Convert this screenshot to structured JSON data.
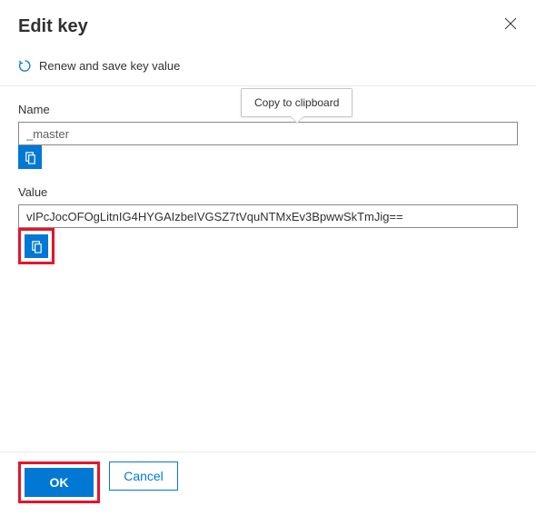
{
  "dialog": {
    "title": "Edit key"
  },
  "toolbar": {
    "renew_label": "Renew and save key value"
  },
  "fields": {
    "name": {
      "label": "Name",
      "value": "_master"
    },
    "value": {
      "label": "Value",
      "value": "vIPcJocOFOgLitnIG4HYGAIzbeIVGSZ7tVquNTMxEv3BpwwSkTmJig=="
    }
  },
  "tooltip": {
    "copy": "Copy to clipboard"
  },
  "footer": {
    "ok_label": "OK",
    "cancel_label": "Cancel"
  }
}
